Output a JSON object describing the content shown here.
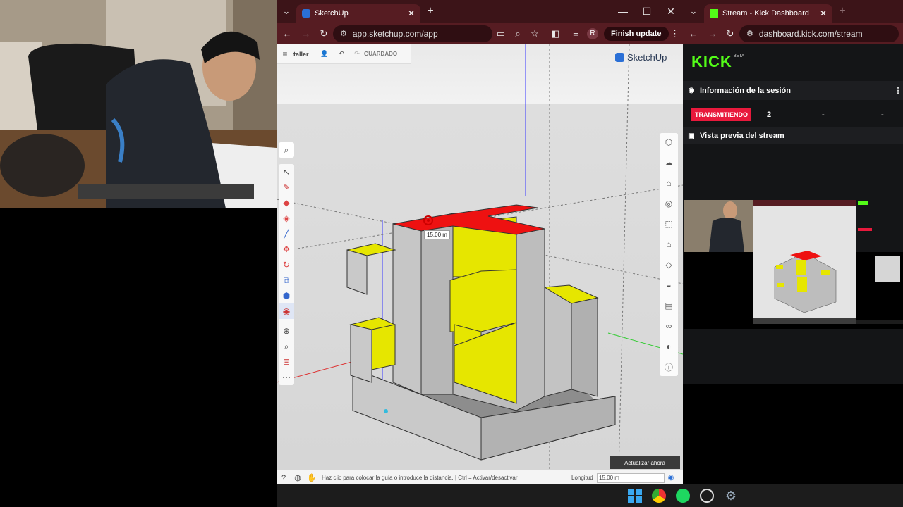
{
  "sketchup_browser": {
    "tab_title": "SketchUp",
    "url": "app.sketchup.com/app",
    "finish_update_label": "Finish update",
    "profile_initial": "R"
  },
  "sketchup": {
    "model_name": "taller",
    "save_status": "GUARDADO",
    "logo_text": "SketchUp",
    "dimension_tooltip": "15.00 m",
    "update_now_label": "Actualizar ahora",
    "status_message": "Haz clic para colocar la guía o introduce la distancia. | Ctrl = Activar/desactivar",
    "measure_label": "Longitud",
    "measure_value": "15.00 m"
  },
  "kick_browser": {
    "tab_title": "Stream - Kick Dashboard",
    "url": "dashboard.kick.com/stream"
  },
  "kick": {
    "logo_text": "KICK",
    "beta_label": "BETA",
    "session_info_title": "Información de la sesión",
    "live_badge": "TRANSMITIENDO",
    "viewers": "2",
    "stat_2": "-",
    "stat_3": "-",
    "preview_title": "Vista previa del stream"
  },
  "colors": {
    "chrome_dark": "#3c1418",
    "chrome_bar": "#561c22",
    "kick_green": "#53fc18",
    "live_red": "#e8193c",
    "face_yellow": "#e6e600",
    "face_red": "#ee1111"
  }
}
